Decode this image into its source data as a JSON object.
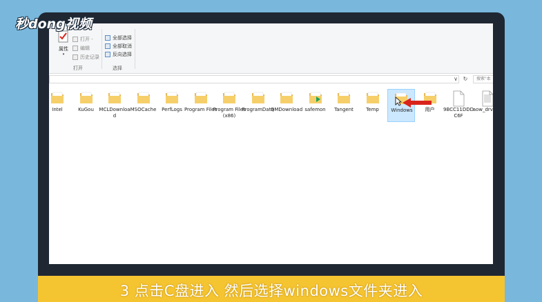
{
  "watermark": {
    "logo_text": "秒dong视频"
  },
  "ribbon": {
    "properties_label": "属性",
    "open_group": {
      "items": [
        {
          "label": "打开 -",
          "disabled": true
        },
        {
          "label": "编辑",
          "disabled": true
        },
        {
          "label": "历史记录",
          "disabled": true
        }
      ],
      "caption": "打开"
    },
    "select_group": {
      "items": [
        {
          "label": "全部选择"
        },
        {
          "label": "全部取消"
        },
        {
          "label": "反向选择"
        }
      ],
      "caption": "选择"
    }
  },
  "address_bar": {
    "dropdown_glyph": "∨",
    "refresh_glyph": "↻",
    "search_placeholder": "搜索\"本"
  },
  "files": [
    {
      "name": "Intel",
      "type": "folder"
    },
    {
      "name": "KuGou",
      "type": "folder"
    },
    {
      "name": "MCLDownload",
      "type": "folder"
    },
    {
      "name": "MSOCache",
      "type": "folder"
    },
    {
      "name": "PerfLogs",
      "type": "folder"
    },
    {
      "name": "Program Files",
      "type": "folder"
    },
    {
      "name": "Program Files (x86)",
      "type": "folder"
    },
    {
      "name": "ProgramData",
      "type": "folder"
    },
    {
      "name": "QMDownload",
      "type": "folder"
    },
    {
      "name": "safemon",
      "type": "folder-app"
    },
    {
      "name": "Tangent",
      "type": "folder"
    },
    {
      "name": "Temp",
      "type": "folder"
    },
    {
      "name": "Windows",
      "type": "folder",
      "selected": true
    },
    {
      "name": "用户",
      "type": "folder"
    },
    {
      "name": "9BCC11DDDC6F",
      "type": "file"
    },
    {
      "name": "aow_drv.log",
      "type": "text-file"
    }
  ],
  "caption": {
    "text": "3 点击C盘进入 然后选择windows文件夹进入"
  },
  "colors": {
    "background": "#79b8dc",
    "caption_bar": "#f5c431",
    "selection": "#cce8ff",
    "arrow": "#d9241c"
  }
}
